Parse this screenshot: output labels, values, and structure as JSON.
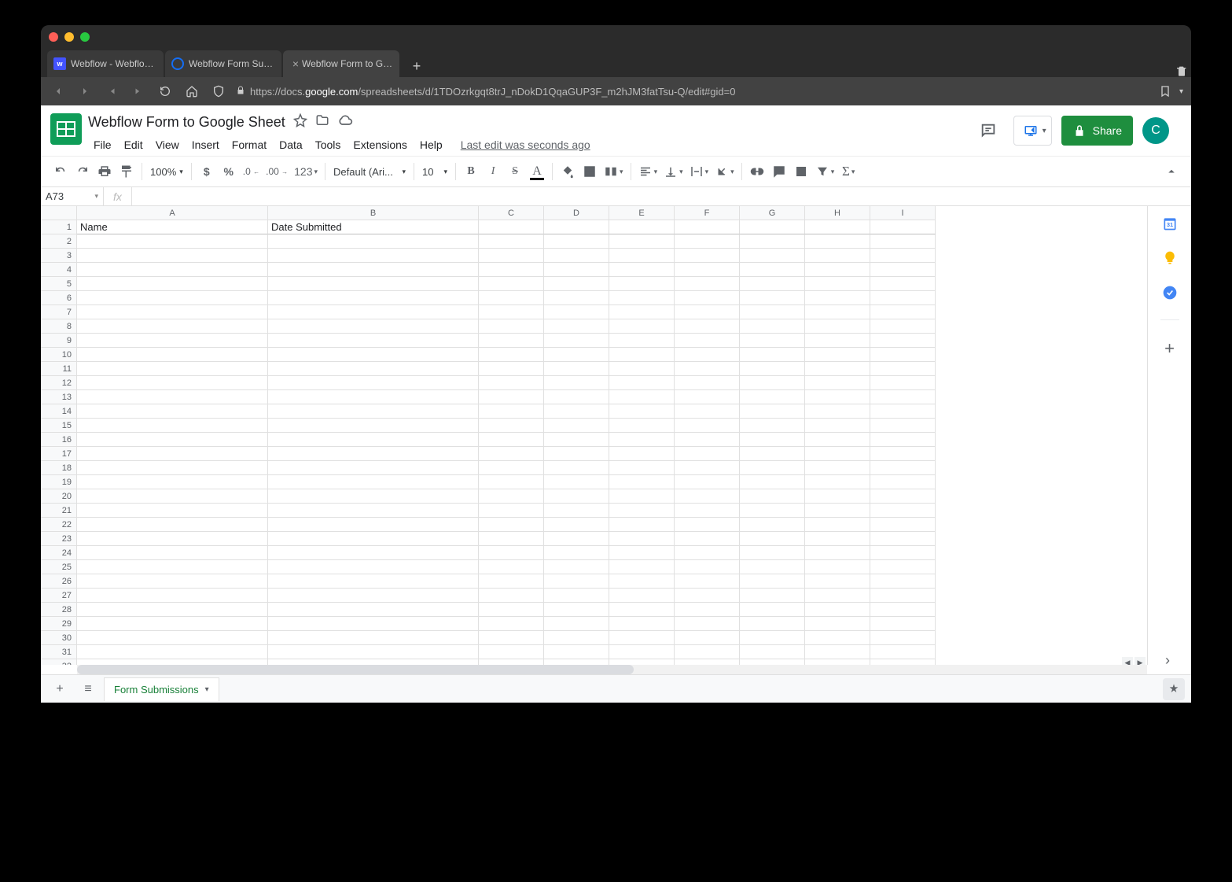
{
  "browser": {
    "tabs": [
      {
        "title": "Webflow - Webflow Form",
        "favicon": "#4353ff"
      },
      {
        "title": "Webflow Form Submit to",
        "favicon": "#146ef5"
      },
      {
        "title": "Webflow Form to Google",
        "favicon": "#0f9d58",
        "active": true
      }
    ],
    "url_prefix": "https://docs.",
    "url_domain": "google.com",
    "url_path": "/spreadsheets/d/1TDOzrkgqt8trJ_nDokD1QqaGUP3F_m2hJM3fatTsu-Q/edit#gid=0"
  },
  "doc": {
    "title": "Webflow Form to Google Sheet",
    "edit_status": "Last edit was seconds ago",
    "share_label": "Share",
    "avatar_letter": "C"
  },
  "menubar": [
    "File",
    "Edit",
    "View",
    "Insert",
    "Format",
    "Data",
    "Tools",
    "Extensions",
    "Help"
  ],
  "toolbar": {
    "zoom": "100%",
    "num_format": "123",
    "font_name": "Default (Ari...",
    "font_size": "10"
  },
  "namebox": "A73",
  "fx_label": "fx",
  "columns": [
    "A",
    "B",
    "C",
    "D",
    "E",
    "F",
    "G",
    "H",
    "I"
  ],
  "row_count": 35,
  "headers_row": {
    "A": "Name",
    "B": "Date Submitted"
  },
  "sheetbar": {
    "sheet_name": "Form Submissions",
    "add": "+",
    "all": "≡"
  }
}
